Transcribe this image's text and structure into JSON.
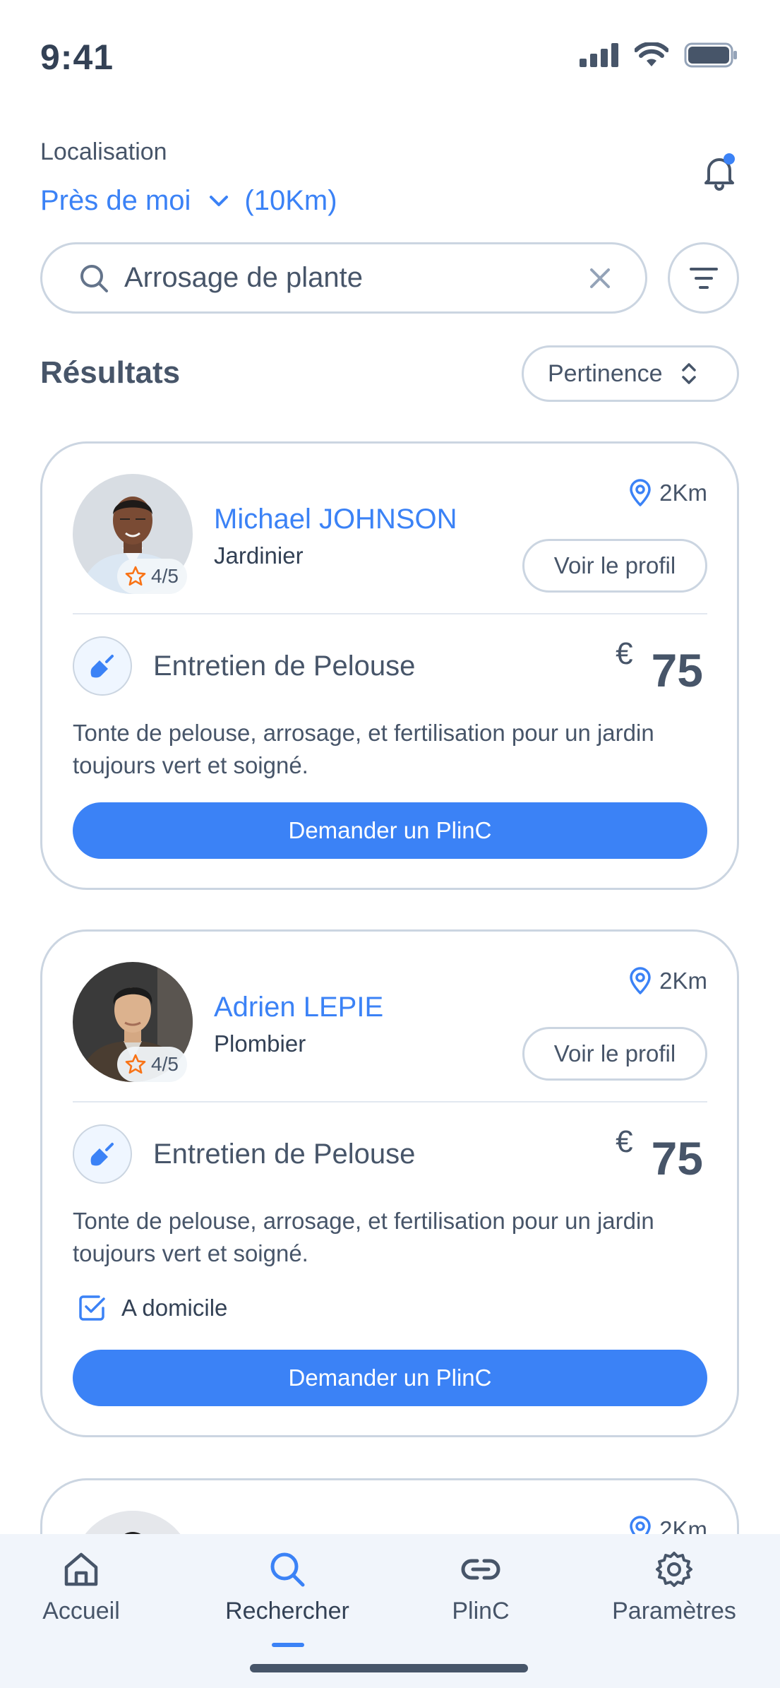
{
  "status": {
    "time": "9:41"
  },
  "header": {
    "location_label": "Localisation",
    "location_value": "Près de moi",
    "radius": "(10Km)"
  },
  "search": {
    "query": "Arrosage de plante"
  },
  "results": {
    "title": "Résultats",
    "sort_label": "Pertinence"
  },
  "cards": [
    {
      "name": "Michael JOHNSON",
      "job": "Jardinier",
      "rating": "4/5",
      "distance": "2Km",
      "profile_button": "Voir le profil",
      "service": "Entretien de Pelouse",
      "currency": "€",
      "price": "75",
      "description": "Tonte de pelouse, arrosage, et fertilisation pour un jardin toujours vert et soigné.",
      "cta": "Demander un PlinC"
    },
    {
      "name": "Adrien LEPIE",
      "job": "Plombier",
      "rating": "4/5",
      "distance": "2Km",
      "profile_button": "Voir le profil",
      "service": "Entretien de Pelouse",
      "currency": "€",
      "price": "75",
      "description": "Tonte de pelouse, arrosage, et fertilisation pour un jardin toujours vert et soigné.",
      "home_option": "A domicile",
      "home_checked": true,
      "cta": "Demander un PlinC"
    },
    {
      "distance": "2Km"
    }
  ],
  "tabbar": {
    "tabs": [
      {
        "label": "Accueil",
        "icon": "home-icon"
      },
      {
        "label": "Rechercher",
        "icon": "search-icon",
        "active": true
      },
      {
        "label": "PlinC",
        "icon": "link-icon"
      },
      {
        "label": "Paramètres",
        "icon": "gear-icon"
      }
    ]
  },
  "colors": {
    "accent": "#3b82f6",
    "text": "#475569",
    "border": "#cbd5e1",
    "rating_star": "#f97316",
    "tabbar_bg": "#f1f5fb"
  }
}
